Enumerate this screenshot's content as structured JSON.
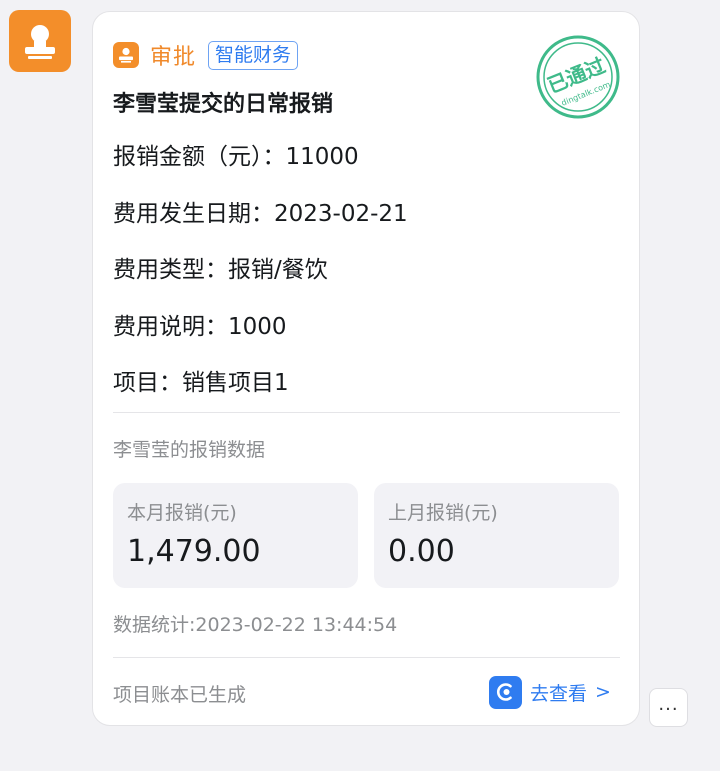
{
  "avatar": {
    "icon": "person-icon",
    "color": "#f38e2a"
  },
  "card": {
    "app_name": "审批",
    "tag": "智能财务",
    "stamp_text": "已通过",
    "stamp_sub": "dingtalk.com",
    "title": "李雪莹提交的日常报销",
    "fields": [
      "报销金额（元）：11000",
      "费用发生日期：2023-02-21",
      "费用类型：报销/餐饮",
      "费用说明：1000",
      "项目：销售项目1"
    ],
    "section_label": "李雪莹的报销数据",
    "stats": [
      {
        "label": "本月报销(元)",
        "value": "1,479.00"
      },
      {
        "label": "上月报销(元)",
        "value": "0.00"
      }
    ],
    "timestamp": "数据统计:2023-02-22 13:44:54",
    "footer_note": "项目账本已生成",
    "view_label": "去查看",
    "view_chevron": ">"
  },
  "more_label": "...",
  "colors": {
    "accent_orange": "#f38e2a",
    "link_blue": "#2f7cf0",
    "stamp_green": "#3fba8a"
  }
}
